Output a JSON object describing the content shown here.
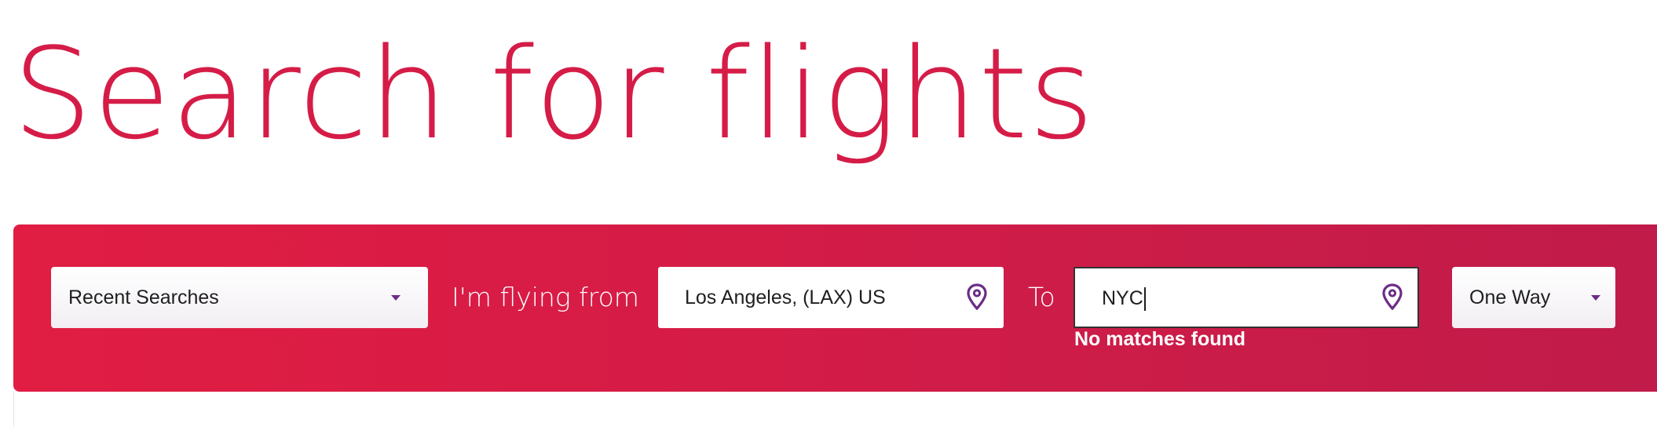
{
  "page": {
    "title": "Search for flights"
  },
  "colors": {
    "brand_red": "#d51c47",
    "bar_gradient_start": "#e11d43",
    "bar_gradient_end": "#c01b4a",
    "accent_purple": "#6b2c87"
  },
  "search": {
    "recent_searches": {
      "label": "Recent Searches",
      "icon": "chevron-down-icon"
    },
    "from": {
      "label": "I'm flying from",
      "value": "Los Angeles, (LAX) US",
      "icon": "location-pin-icon"
    },
    "to": {
      "label": "To",
      "value": "NYC",
      "icon": "location-pin-icon",
      "error": "No matches found"
    },
    "trip_type": {
      "selected": "One Way",
      "icon": "chevron-down-icon"
    }
  }
}
